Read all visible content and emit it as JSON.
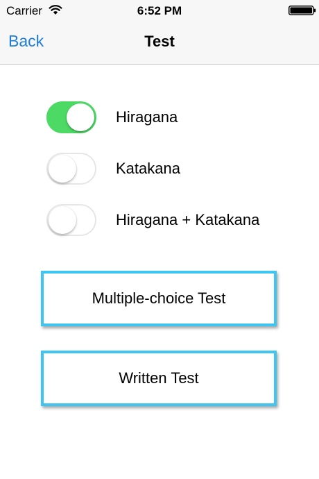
{
  "status_bar": {
    "carrier": "Carrier",
    "time": "6:52 PM",
    "wifi_icon": "wifi-icon",
    "battery_icon": "battery-icon"
  },
  "nav": {
    "back_label": "Back",
    "title": "Test"
  },
  "toggles": [
    {
      "label": "Hiragana",
      "on": true
    },
    {
      "label": "Katakana",
      "on": false
    },
    {
      "label": "Hiragana + Katakana",
      "on": false
    }
  ],
  "buttons": {
    "multiple_choice": "Multiple-choice Test",
    "written": "Written Test"
  },
  "colors": {
    "accent": "#1e7cd6",
    "switch_on": "#4cd964",
    "button_border": "#40c4f0"
  }
}
